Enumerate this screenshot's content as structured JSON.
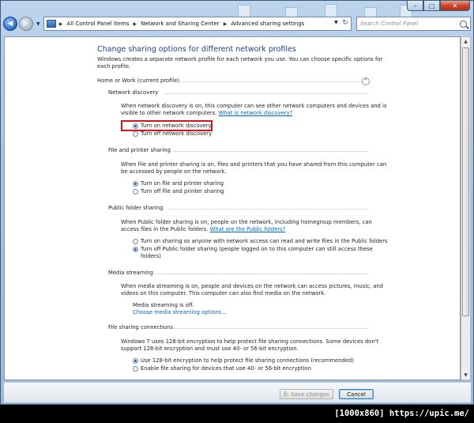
{
  "window": {
    "controls": {
      "minimize": "–",
      "maximize": "□",
      "close": "✕"
    }
  },
  "nav": {
    "back": "◀",
    "forward": "▶",
    "breadcrumbs": [
      "All Control Panel Items",
      "Network and Sharing Center",
      "Advanced sharing settings"
    ],
    "search_placeholder": "Search Control Panel"
  },
  "page": {
    "title": "Change sharing options for different network profiles",
    "intro": [
      "Windows creates a separate network profile for each network you use. You can choose specific options for",
      "each profile."
    ],
    "profile": "Home or Work (current profile)",
    "sections": {
      "discovery": {
        "heading": "Network discovery",
        "desc1": "When network discovery is on, this computer can see other network computers and devices and is",
        "desc2": "visible to other network computers.",
        "link": "What is network discovery?",
        "opt1": "Turn on network discovery",
        "opt2": "Turn off network discovery"
      },
      "printer": {
        "heading": "File and printer sharing",
        "desc1": "When file and printer sharing is on, files and printers that you have shared from this computer can",
        "desc2": "be accessed by people on the network.",
        "opt1": "Turn on file and printer sharing",
        "opt2": "Turn off file and printer sharing"
      },
      "public": {
        "heading": "Public folder sharing",
        "desc1": "When Public folder sharing is on, people on the network, including homegroup members, can",
        "desc2": "access files in the Public folders.",
        "link": "What are the Public folders?",
        "opt1": "Turn on sharing so anyone with network access can read and write files in the Public folders",
        "opt2a": "Turn off Public folder sharing (people logged on to this computer can still access these",
        "opt2b": "folders)"
      },
      "media": {
        "heading": "Media streaming",
        "desc1": "When media streaming is on, people and devices on the network can access pictures, music, and",
        "desc2": "videos on this computer. This computer can also find media on the network.",
        "status": "Media streaming is off.",
        "link": "Choose media streaming options..."
      },
      "filesharing": {
        "heading": "File sharing connections",
        "desc1": "Windows 7 uses 128-bit encryption to help protect file sharing connections. Some devices don't",
        "desc2": "support 128-bit encryption and must use 40- or 56-bit encryption.",
        "opt1": "Use 128-bit encryption to help protect file sharing connections (recommended)",
        "opt2": "Enable file sharing for devices that use 40- or 56-bit encryption"
      }
    }
  },
  "footer": {
    "save": "Save changes",
    "cancel": "Cancel"
  },
  "watermark": "[1000x860] https://upic.me/"
}
